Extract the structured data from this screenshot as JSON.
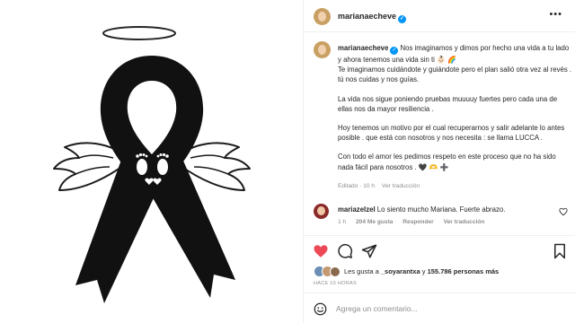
{
  "post": {
    "username": "marianaecheve",
    "verified_mark": "✓",
    "more_label": "•••",
    "caption": {
      "username": "marianaecheve",
      "lines": [
        "Nos imaginamos y dimos por hecho una vida a tu lado y ahora tenemos una vida sin ti 👶🏻 🌈",
        "Te imaginamos cuidándote y guiándote pero el plan salió otra vez al revés . tú nos cuidas y nos guías.",
        "La vida nos sigue poniendo pruebas muuuuy fuertes pero cada una de ellas nos da mayor resiliencia .",
        "Hoy tenemos un motivo por el cual recuperarnos y salir adelante lo antes posible . que está con nosotros y nos necesita : se llama LUCCA .",
        "Con todo el amor les pedimos respeto en este proceso que no ha sido nada fácil para nosotros . 🖤 🫶 ➕"
      ],
      "edited": "Editado · 10 h",
      "translate": "Ver traducción"
    },
    "comment": {
      "username": "mariazelzel",
      "text": "Lo siento mucho Mariana. Fuerte abrazo.",
      "time": "1 h",
      "likes": "204 Me gusta",
      "reply": "Responder",
      "translate": "Ver traducción"
    },
    "likes": {
      "prefix": "Les gusta a",
      "user": "_soyarantxa",
      "connector": "y",
      "count": "155.786 personas más"
    },
    "time_ago": "HACE 10 HORAS",
    "add_comment": {
      "placeholder": "Agrega un comentario..."
    }
  },
  "icons": {
    "like": "heart-filled-icon",
    "comment": "comment-icon",
    "share": "paper-plane-icon",
    "save": "bookmark-icon",
    "emoji": "smiley-icon"
  },
  "colors": {
    "like_red": "#ed4956",
    "verified_blue": "#0095f6",
    "muted_text": "#8e8e8e"
  }
}
